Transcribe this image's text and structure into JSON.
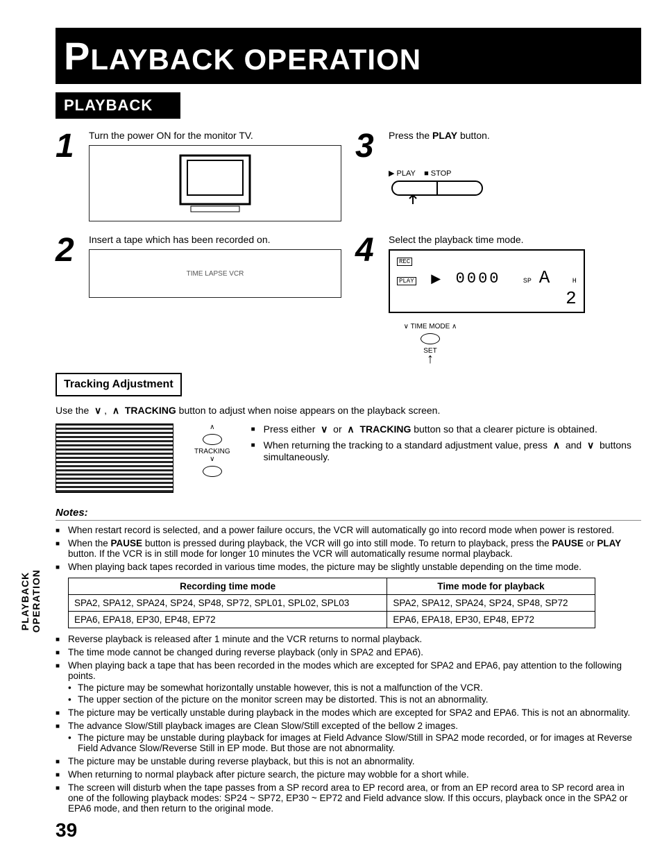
{
  "title": "PLAYBACK OPERATION",
  "section": "PLAYBACK",
  "steps": [
    {
      "n": "1",
      "text": "Turn the power ON for the monitor TV."
    },
    {
      "n": "2",
      "text": "Insert a tape which has been recorded on."
    },
    {
      "n": "3",
      "text": "Press the PLAY button."
    },
    {
      "n": "4",
      "text": "Select the playback time mode."
    }
  ],
  "play_label": "▶ PLAY",
  "stop_label": "■ STOP",
  "lcd": {
    "badge_rec": "REC",
    "badge_play": "PLAY",
    "counter": "0000",
    "sp": "SP",
    "a": "A",
    "h": "H",
    "two": "2"
  },
  "timemode_label": "∨ TIME MODE ∧",
  "set_label": "SET",
  "tracking_box": "Tracking Adjustment",
  "tracking_desc": "Use the  ∨ ,  ∧  TRACKING button to adjust when noise appears on the playback screen.",
  "trk_btn_label": "TRACKING",
  "tracking_bullets": [
    "Press either  ∨  or  ∧  TRACKING button so that a clearer picture is obtained.",
    "When returning the tracking to a standard adjustment value, press  ∧  and  ∨  buttons simultaneously."
  ],
  "notes_head": "Notes:",
  "notes": [
    "When restart record is selected, and a power failure occurs, the VCR will automatically go into record mode when power is restored.",
    "When the PAUSE button is pressed during playback, the VCR will go into still mode. To return to playback, press the PAUSE or PLAY button. If the VCR is in still mode for longer 10 minutes the VCR will automatically resume normal playback.",
    "When playing back tapes recorded in various time modes, the picture may be slightly unstable depending on the time mode."
  ],
  "table": {
    "h1": "Recording time mode",
    "h2": "Time mode for playback",
    "r1c1": "SPA2, SPA12, SPA24, SP24, SP48, SP72, SPL01, SPL02, SPL03",
    "r1c2": "SPA2, SPA12, SPA24, SP24, SP48, SP72",
    "r2c1": "EPA6, EPA18, EP30, EP48, EP72",
    "r2c2": "EPA6, EPA18, EP30, EP48, EP72"
  },
  "notes2": [
    {
      "t": "Reverse playback is released after 1 minute and the VCR returns to normal playback."
    },
    {
      "t": "The time mode cannot be changed during reverse playback (only in SPA2 and EPA6)."
    },
    {
      "t": "When playing back a tape that has been recorded in the modes which are excepted for SPA2 and EPA6, pay attention to the following points.",
      "sub": [
        "The picture may be somewhat horizontally unstable however, this is not a malfunction of the VCR.",
        "The upper section of the picture on the monitor screen may be distorted. This is not an abnormality."
      ]
    },
    {
      "t": "The picture may be vertically unstable during playback in the modes which are excepted for SPA2 and EPA6. This is not an abnormality."
    },
    {
      "t": "The advance Slow/Still playback images are Clean Slow/Still excepted of the bellow 2 images.",
      "sub": [
        "The picture may be unstable during playback for images at Field Advance Slow/Still in SPA2 mode recorded, or for images at Reverse Field Advance Slow/Reverse Still in EP mode. But those are not abnormality."
      ]
    },
    {
      "t": "The picture may be unstable during reverse playback, but this is not an abnormality."
    },
    {
      "t": "When returning to normal playback after picture search, the picture may wobble for a short while."
    },
    {
      "t": "The screen will disturb when the tape passes from a SP record area to EP record area, or from an EP record area to SP record area in one of the following playback modes: SP24 ~ SP72, EP30 ~ EP72 and Field advance slow. If this occurs, playback once in the SPA2 or EPA6 mode, and then return to the original mode."
    }
  ],
  "side_tab": "PLAYBACK\nOPERATION",
  "page_num": "39",
  "vcr_illus_label": "TIME LAPSE VCR"
}
